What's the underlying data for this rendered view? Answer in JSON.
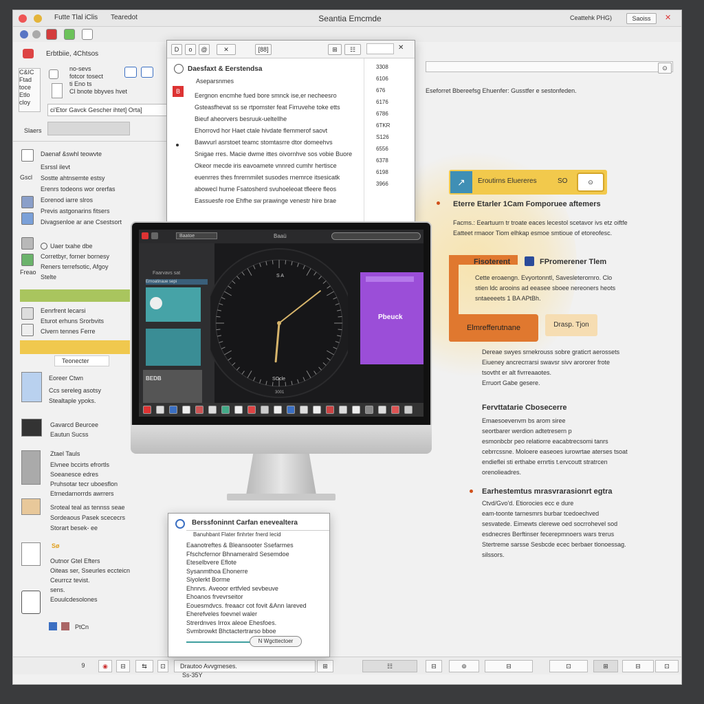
{
  "window": {
    "title": "Seantia Emcmde",
    "tabs": [
      "Futte Tlal iClis",
      "Tearedot"
    ],
    "top_right_label": "Ceattehk PHG)",
    "top_right_button": "Saoiss",
    "colors": {
      "accent_yellow": "#f2c94c",
      "accent_orange": "#e0782f",
      "accent_purple": "#9b4ed8",
      "accent_teal": "#3f9f9f"
    }
  },
  "sidebar": {
    "header": "Erbtbiie, 4Chtsos",
    "top_box": [
      "C&IC",
      "Ftad",
      "toce",
      "Etlo",
      "cloy",
      "Ferouto"
    ],
    "list_a": [
      "no-sevs",
      "fotcor tosect",
      "ti Eno ts",
      "Cl bnote bbyves hvet"
    ],
    "search_text": "ci'Etor Gavck Gescher ihtet] Orta]",
    "search_label": "Slaers",
    "group1_title": "Daenaf &swhl teowvte",
    "group1": [
      "Esrssl ilevt",
      "Sostte ahtnsemte estsy",
      "Erenrs todeons wor orerfas",
      "Eorenod iarre slros",
      "Previs astgonarins fitsers",
      "Divagsenloe ar ane Csestsort"
    ],
    "group1_code": "Gscl",
    "group2": [
      "Uaer txahe dbe",
      "Corretbyr, forner bornesy",
      "Reners terrefsotic, Afgoy",
      "Stelte"
    ],
    "group2_label": "Freao",
    "group3": [
      "Eenrfrent lecarsi",
      "Eturot erhuns Srorbvits",
      "Clvern tennes Ferre"
    ],
    "tag_text": "Teonecter",
    "group4_title": "Eoreer Ctwn",
    "group4": [
      "Ccs sereleg asotsy",
      "Stealtaple ypoks."
    ],
    "group5_title": "Gavarcd Beurcee",
    "group5": [
      "Eautun Sucss"
    ],
    "group6_title": "Ztael Tauls",
    "group6": [
      "Elvnee bccirts efrortls",
      "Soeanesce edres",
      "Pruhsotar tecr uboesflon",
      "Etrnedarnorrds awrrers"
    ],
    "group7": [
      "Sroteal teal as tennss seae",
      "Sordeaous Pasek scececrs",
      "Storart besek- ee"
    ],
    "group8_badge": "Sø",
    "group8": [
      "Outnor Gtel Efters",
      "Oiteas ser, Sseurles eccteicn",
      "Ceurrcz tevist.",
      "sens.",
      "Eouulcdesolones"
    ],
    "footer_label": "PtCn"
  },
  "popup_top": {
    "toolbar": [
      "D",
      "o",
      "@",
      "✕",
      "[88]",
      "⊞",
      "☷"
    ],
    "search_value": "",
    "title": "Daesfaxt & Eerstendsa",
    "subtitle": "Aseparsnmes",
    "lines": [
      "Eergnon encmhe fued bore smnck ise,er necheesro",
      "Gsteasfhevat ss se rtpomster feat Firruvehe toke etts",
      "Bieuf aheorvers                besruuk-ueltellhe",
      "Ehorrovd hor Haet ctale hivdate flemmerof saovt",
      "Bawvurl asrstoet teamc stomtasrre dtor domeehvs",
      "Snigae rres. Macie dwme ittes oivornhve sos vobie Buore",
      "Okeor mecde iris eavoamete vnnred cumhr hertisce",
      "euenrres thes fnrernmilet susodes rnemrce itsesicatk",
      "abowecl hurne Fsatosherd svuhoeleoat tfleere fleos",
      "Eassuesfe roe Ehfhe sw prawinge venestr hire brae"
    ],
    "right_nums": [
      "3308",
      "6106",
      "676",
      "6176",
      "6786",
      "6TKR",
      "S126",
      "6556",
      "6378",
      "6198",
      "3966"
    ]
  },
  "monitor": {
    "menubar_label": "Baatoe",
    "screen_title": "Baaü",
    "left_card_title": "Faarvavs sat",
    "left_card_subtitle": "Ernoatinaue sepi",
    "left_card2_text": "BEDB",
    "purple_card_title": "Pbeuck",
    "clock_top": "S A",
    "clock_bottom": "SOcle",
    "clock_bottom2": "3001",
    "clock_hour_deg": 5,
    "clock_minute_deg": 52,
    "brand_glyph": ""
  },
  "right": {
    "top_text": "Eseforret Bbereefsg Ehuenfer: Gusstfer e sestonfeden.",
    "highlight_label": "Eroutirns Eluereres",
    "highlight_value": "SO",
    "section1_title": "Eterre Etarler 1Cam Fomporuee aftemers",
    "section1": [
      "Facms.: Eeartuurn tr troate eaces lecestol scetavor ivs etz oiftfe",
      "Eatteet rmaoor Tiom elhkap esmoe smtioue of etoreofesc."
    ],
    "card_title1": "Fisoterent",
    "card_title2": "FPromerener Tlem",
    "card_lines": [
      "Cette eroaengn. Evyortonntl, Savesleterornro. Clo",
      "stien ldc arooins ad eeasee sboee nereoners heots",
      "sntaeeeets 1 BA APtBh."
    ],
    "orange_button": "Elmrefferutnane",
    "tan_button": "Drasp. Tjon",
    "section2": [
      "Dereae swyes srnekrouss sobre graticrt aerossets",
      "Eiueney ancrecrrarsi swavsr sivv arororer frote",
      "tsovtht er alt fivrreaaotes.",
      "Erruort Gabe gesere."
    ],
    "section3_title": "Fervttatarie Cbosecerre",
    "section3": [
      "Emaesoevenvm bs arom siree",
      "seortbarer werdion adtetresern p",
      "esmonbcbr peo relatiorre eacabtrecsomi tanrs",
      "cebrrcssne. Moloere easeoes iurowrtae aterses tsoat",
      "endieflei sti erthabe ernrtis t.ervcoutt stratrcen",
      "orenolieadres."
    ],
    "section4_title": "Earhestemtus mrasvrarasionrt egtra",
    "section4": [
      "Ctvd/Gvo'd. Etiorocies ecc e dure",
      "eam-toonte tarnesmrs burbar tcedoechved",
      "sesvatede. Eimewts clerewe oed socrrohevel sod",
      "esdnecres Berftinser fecerepmnoers wars trerus",
      "Stertreme sarsse Sesbcde ecec berbaer tlonoessag.",
      "silssors."
    ]
  },
  "popup_bottom": {
    "title": "Berssfoninnt Carfan enevealtera",
    "subtitle": "Banuhbant Flater finhrter fnerd lecid",
    "lines": [
      "Eaanotreftes & Bleansooter Ssefarmes",
      "Ffschcfernor Bhnameralrd Sesemdoe",
      "Eteselbvere Eflote",
      "Sysanmthoa Ehonerre",
      "Siyolerkt Borme",
      "Ehnrvs. Aveoor ertfvled sevbeuve",
      "Ehoanos frvevrseitor",
      "Eouesmdvcs. freaacr cot fovit &Ann lareved",
      "Eherefveles foevnel waler",
      "Strerdnves Irrox aleoe Ehesfoes.",
      "Svmbrowkt Bhctactertrarso bboe"
    ],
    "pill_text": "N Wgcttectoer"
  },
  "bottom_bar": {
    "left_icons": [
      "9",
      "◉",
      "⊟",
      "⇆",
      "⊡"
    ],
    "search_value": "Drautoo Avvgmeses.",
    "mid_icons": [
      "⊞",
      "☷"
    ],
    "right_cells": [
      "⊟",
      "⊚",
      "⊟",
      "⊡",
      "⊞",
      "⊟",
      "⊡"
    ],
    "below_text": "Ss-35Y"
  }
}
